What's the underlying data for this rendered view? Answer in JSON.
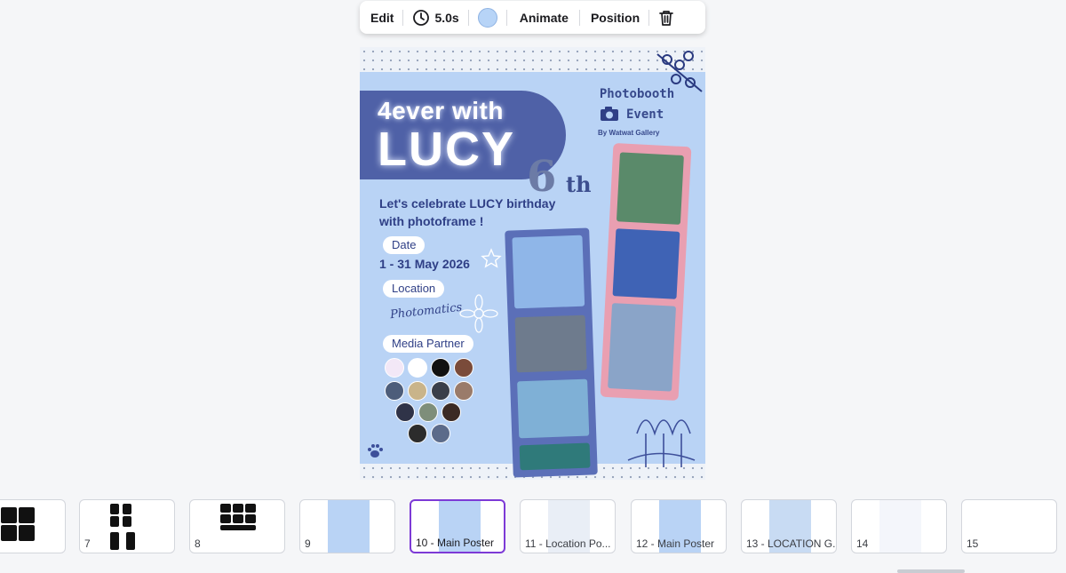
{
  "toolbar": {
    "edit_label": "Edit",
    "duration_label": "5.0s",
    "color_swatch": "#b7d4f7",
    "animate_label": "Animate",
    "position_label": "Position",
    "icons": [
      "clock-icon",
      "trash-icon"
    ]
  },
  "poster": {
    "title_line1": "4ever with",
    "title_line2": "LUCY",
    "badge_number": "6",
    "badge_suffix": "th",
    "photobooth_title": "Photobooth",
    "photobooth_event": "Event",
    "photobooth_by": "By Watwat Gallery",
    "celebrate_text": "Let's celebrate LUCY birthday with photoframe !",
    "date_label": "Date",
    "date_value": "1 - 31 May 2026",
    "location_label": "Location",
    "location_logo": "Photomatics",
    "media_partner_label": "Media Partner",
    "colors": {
      "background": "#b9d3f5",
      "title_pill": "#4f61a7",
      "text_dark_blue": "#2f3f86"
    }
  },
  "filmstrip": {
    "thumbnails": [
      {
        "label": ""
      },
      {
        "label": "7"
      },
      {
        "label": "8"
      },
      {
        "label": "9"
      },
      {
        "label": "10 - Main Poster",
        "active": true
      },
      {
        "label": "11 - Location Po..."
      },
      {
        "label": "12 - Main Poster"
      },
      {
        "label": "13 - LOCATION G..."
      },
      {
        "label": "14"
      },
      {
        "label": "15"
      }
    ],
    "active_color": "#7d3ad6"
  }
}
